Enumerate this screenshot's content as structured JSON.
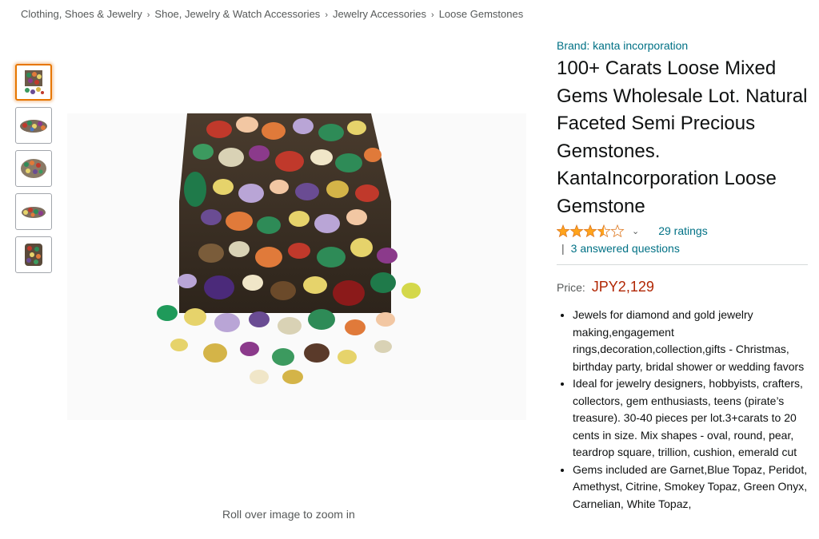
{
  "breadcrumb": {
    "items": [
      "Clothing, Shoes & Jewelry",
      "Shoe, Jewelry & Watch Accessories",
      "Jewelry Accessories",
      "Loose Gemstones"
    ],
    "separator": "›"
  },
  "gallery": {
    "thumbnail_count": 5,
    "active_index": 0,
    "zoom_hint": "Roll over image to zoom in"
  },
  "product": {
    "brand": "Brand: kanta incorporation",
    "title": "100+ Carats Loose Mixed Gems Wholesale Lot. Natural Faceted Semi Precious Gemstones. KantaIncorporation Loose Gemstone",
    "rating": {
      "value": 3.5,
      "out_of": 5,
      "ratings_text": "29 ratings",
      "star_color": "#ffa41c"
    },
    "questions": {
      "pipe": "|",
      "text": "3 answered questions"
    },
    "price": {
      "label": "Price:",
      "value": "JPY2,129",
      "color": "#b12704"
    },
    "bullets": [
      "Jewels for diamond and gold jewelry making,engagement rings,decoration,collection,gifts - Christmas, birthday party, bridal shower or wedding favors",
      "Ideal for jewelry designers, hobbyists, crafters, collectors, gem enthusiasts, teens (pirate’s treasure). 30-40 pieces per lot.3+carats to 20 cents in size. Mix shapes - oval, round, pear, teardrop square, trillion, cushion, emerald cut",
      "Gems included are Garnet,Blue Topaz, Peridot, Amethyst, Citrine, Smokey Topaz, Green Onyx, Carnelian, White Topaz,"
    ]
  },
  "colors": {
    "link": "#007185",
    "accent_border": "#e77600"
  }
}
